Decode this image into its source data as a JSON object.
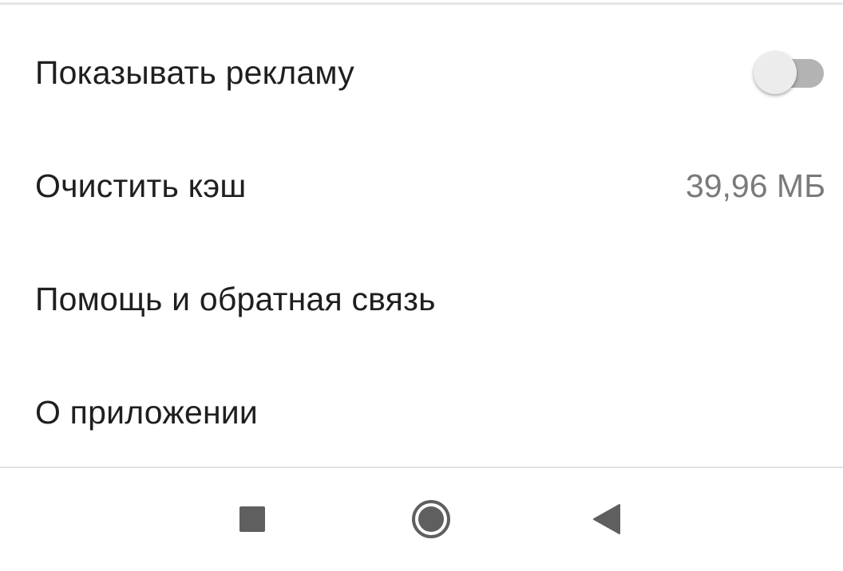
{
  "settings": {
    "items": [
      {
        "label": "Показывать рекламу",
        "control": "toggle",
        "toggle_on": false
      },
      {
        "label": "Очистить кэш",
        "value": "39,96 МБ"
      },
      {
        "label": "Помощь и обратная связь"
      },
      {
        "label": "О приложении"
      }
    ]
  },
  "navbar": {
    "buttons": [
      {
        "icon": "recents-square-icon"
      },
      {
        "icon": "home-circle-icon"
      },
      {
        "icon": "back-triangle-icon"
      }
    ]
  },
  "colors": {
    "text_primary": "#1f1f1f",
    "text_secondary": "#7a7a7a",
    "toggle_track": "#b3b3b3",
    "toggle_thumb": "#ececec",
    "nav_icon": "#5f5f5f"
  }
}
